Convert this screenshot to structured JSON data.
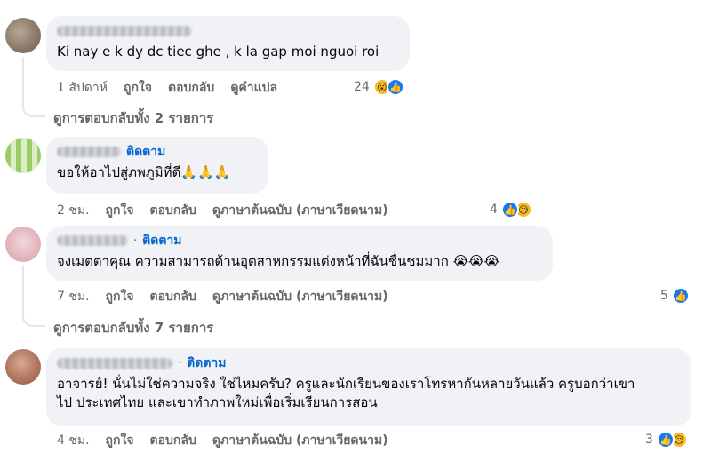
{
  "comments": [
    {
      "text": "Ki nay e k dy dc tiec ghe , k la gap moi nguoi roi",
      "follow": "",
      "time": "1 สัปดาห์",
      "like": "ถูกใจ",
      "reply": "ตอบกลับ",
      "translate": "ดูคำแปล",
      "reaction_count": "24",
      "reaction_icons": [
        "wow-icon",
        "like-icon"
      ],
      "view_replies": "ดูการตอบกลับทั้ง 2 รายการ"
    },
    {
      "text": "ขอให้อาไปสู่ภพภูมิที่ดี🙏🙏🙏",
      "follow": "ติดตาม",
      "time": "2 ชม.",
      "like": "ถูกใจ",
      "reply": "ตอบกลับ",
      "translate": "ดูภาษาต้นฉบับ (ภาษาเวียดนาม)",
      "reaction_count": "4",
      "reaction_icons": [
        "like-icon",
        "sad-icon"
      ]
    },
    {
      "text": "จงเมตตาคุณ ความสามารถด้านอุตสาหกรรมแต่งหน้าที่ฉันชื่นชมมาก 😭😭😭",
      "follow": "ติดตาม",
      "time": "7 ชม.",
      "like": "ถูกใจ",
      "reply": "ตอบกลับ",
      "translate": "ดูภาษาต้นฉบับ (ภาษาเวียดนาม)",
      "reaction_count": "5",
      "reaction_icons": [
        "like-icon"
      ],
      "view_replies": "ดูการตอบกลับทั้ง 7 รายการ"
    },
    {
      "text_line1": "อาจารย์! นั่นไม่ใช่ความจริง ใช่ไหมครับ? ครูและนักเรียนของเราโทรหากันหลายวันแล้ว ครูบอกว่าเขา",
      "text_line2": "ไป ประเทศไทย และเขาทำภาพใหม่เพื่อเริ่มเรียนการสอน",
      "follow": "ติดตาม",
      "time": "4 ชม.",
      "like": "ถูกใจ",
      "reply": "ตอบกลับ",
      "translate": "ดูภาษาต้นฉบับ (ภาษาเวียดนาม)",
      "reaction_count": "3",
      "reaction_icons": [
        "like-icon",
        "sad-icon"
      ]
    }
  ],
  "colors": {
    "bubble": "#f0f2f5",
    "follow_link": "#0566d0",
    "meta_text": "#65676b",
    "like_blue": "#1877f2",
    "emoji_yellow": "#f7b928"
  }
}
